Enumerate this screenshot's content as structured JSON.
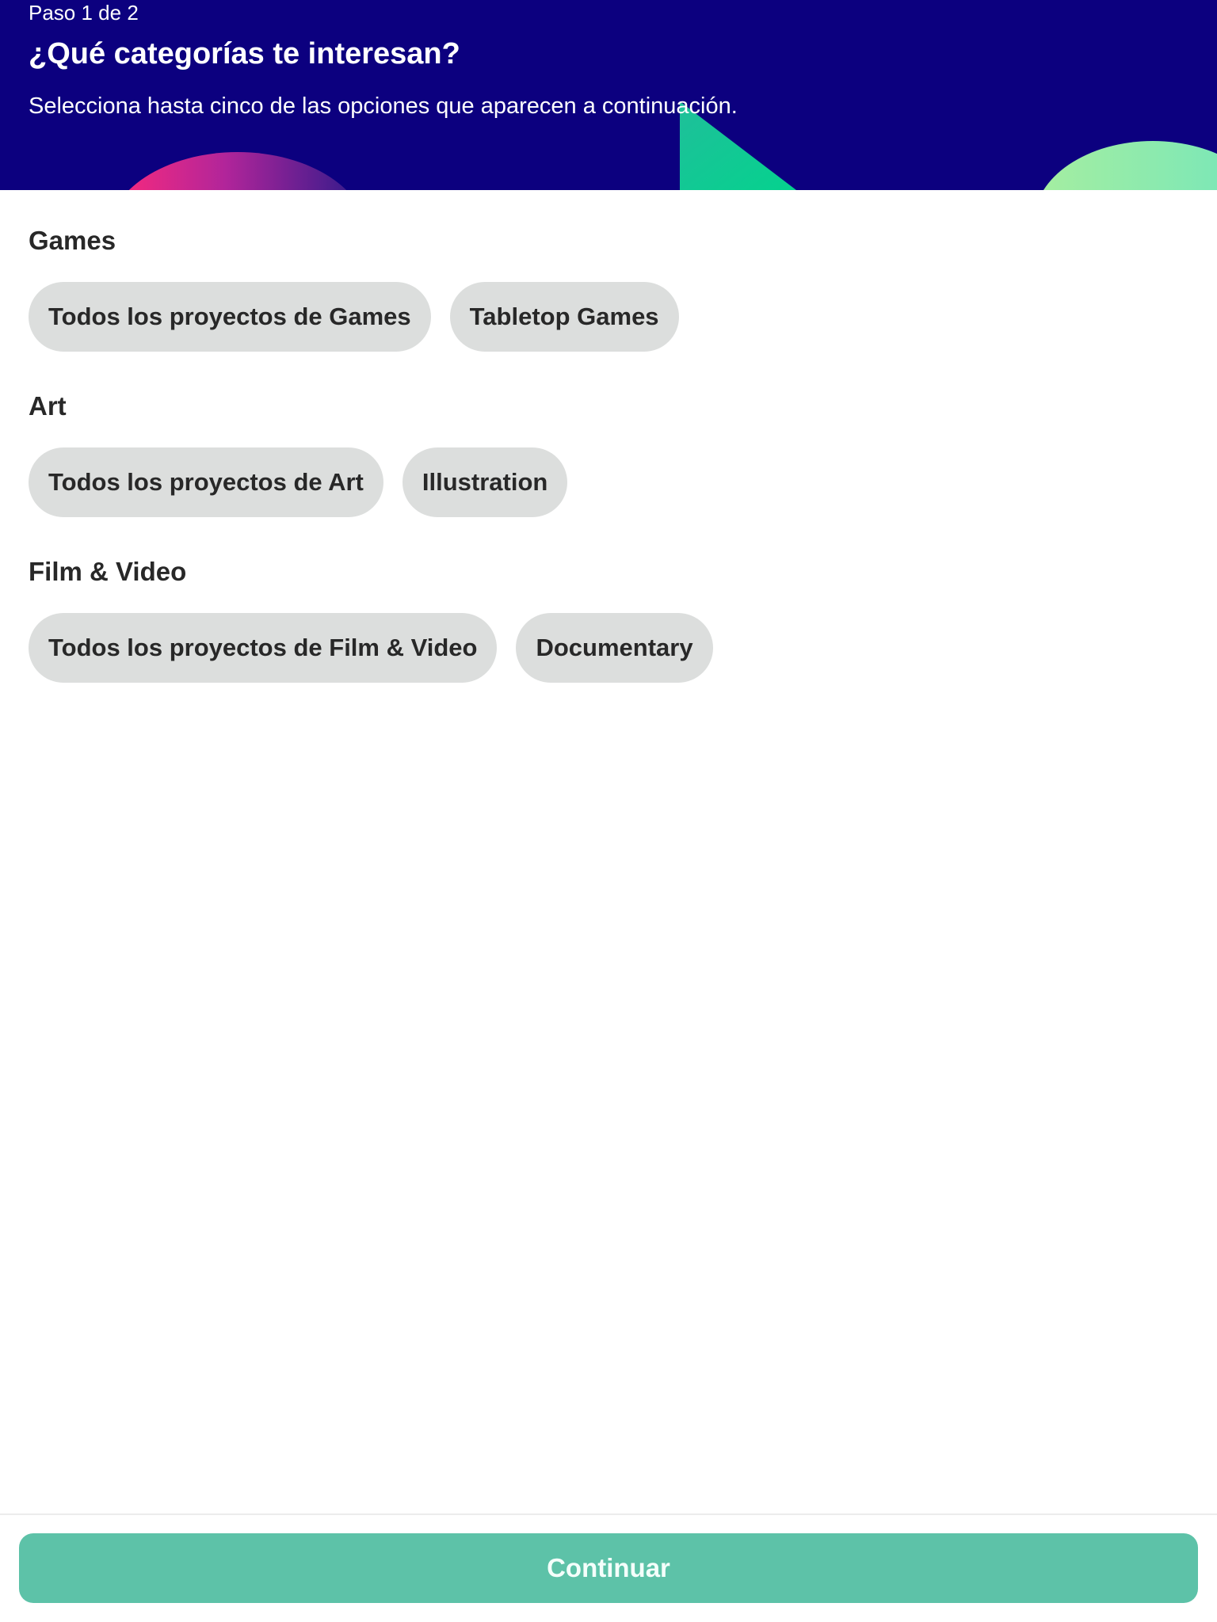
{
  "header": {
    "step": "Paso 1 de 2",
    "title": "¿Qué categorías te interesan?",
    "subtitle": "Selecciona hasta cinco de las opciones que aparecen a continuación."
  },
  "sections": [
    {
      "title": "Games",
      "options": [
        "Todos los proyectos de Games",
        "Tabletop Games"
      ]
    },
    {
      "title": "Art",
      "options": [
        "Todos los proyectos de Art",
        "Illustration"
      ]
    },
    {
      "title": "Film & Video",
      "options": [
        "Todos los proyectos de Film & Video",
        "Documentary"
      ]
    }
  ],
  "footer": {
    "continue_label": "Continuar"
  },
  "colors": {
    "header_background": "#0c007f",
    "chip_background": "#dcdedd",
    "primary_button": "#5dc2a8"
  }
}
